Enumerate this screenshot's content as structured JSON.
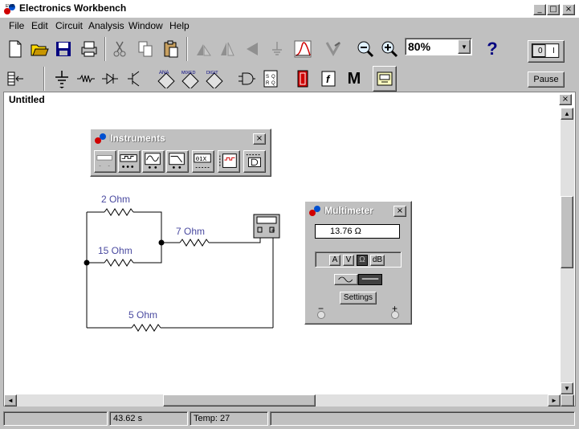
{
  "app": {
    "title": "Electronics Workbench"
  },
  "menu": [
    "File",
    "Edit",
    "Circuit",
    "Analysis",
    "Window",
    "Help"
  ],
  "toolbar": {
    "zoom": "80%",
    "help": "?",
    "pause": "Pause",
    "power_off": "0",
    "power_on": "I"
  },
  "parts_bin": {
    "ana": "ANA",
    "mixed": "MIXED",
    "digit": "DIGIT",
    "misc": "M",
    "func": "f"
  },
  "document": {
    "title": "Untitled"
  },
  "instruments_panel": {
    "title": "Instruments"
  },
  "circuit": {
    "resistors": [
      {
        "label": "2 Ohm"
      },
      {
        "label": "15 Ohm"
      },
      {
        "label": "7 Ohm"
      },
      {
        "label": "5 Ohm"
      }
    ]
  },
  "multimeter": {
    "title": "Multimeter",
    "reading": "13.76  Ω",
    "modes": [
      "A",
      "V",
      "Ω",
      "dB"
    ],
    "active_mode": "Ω",
    "settings_label": "Settings",
    "minus": "−",
    "plus": "+"
  },
  "status": {
    "time": "43.62 s",
    "temp": "Temp:  27"
  },
  "colors": {
    "wire": "#000000",
    "label": "#4a4aa0",
    "title_gradient": "#000080"
  }
}
